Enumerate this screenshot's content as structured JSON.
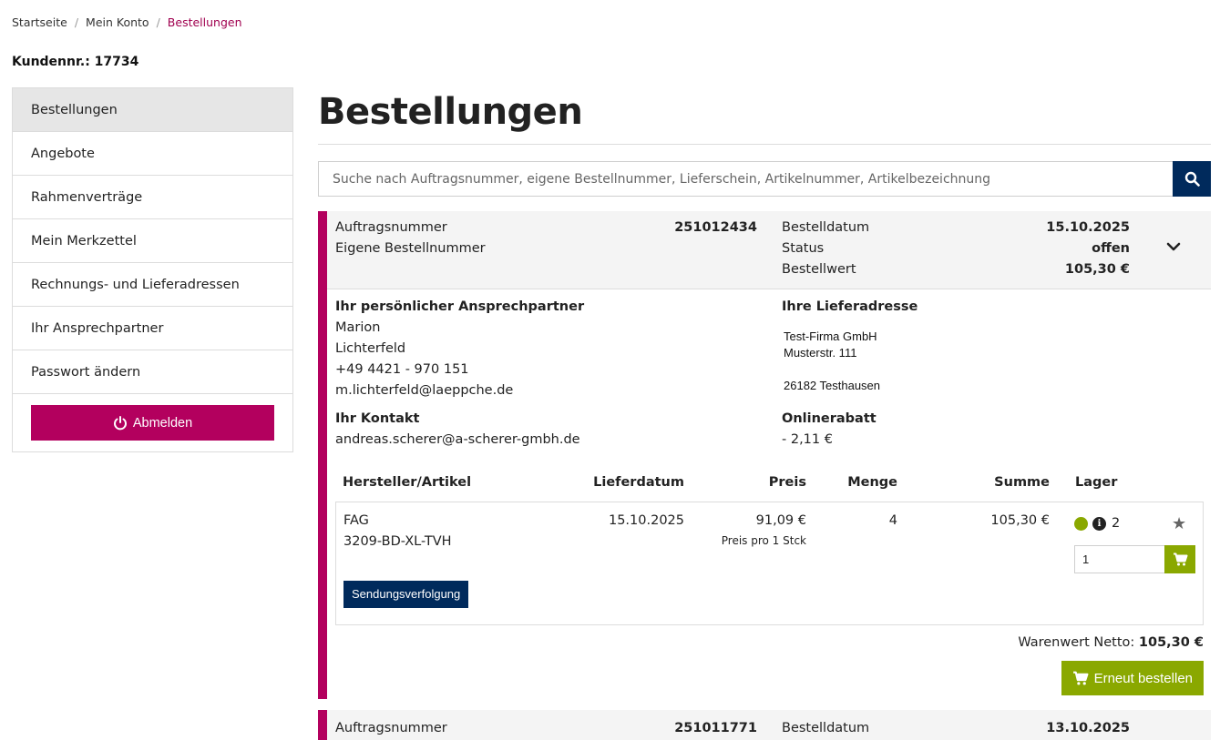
{
  "breadcrumb": {
    "home": "Startseite",
    "account": "Mein Konto",
    "current": "Bestellungen",
    "sep": "/"
  },
  "customer": "Kundennr.: 17734",
  "sidebar": {
    "items": [
      {
        "label": "Bestellungen"
      },
      {
        "label": "Angebote"
      },
      {
        "label": "Rahmenverträge"
      },
      {
        "label": "Mein Merkzettel"
      },
      {
        "label": "Rechnungs- und Lieferadressen"
      },
      {
        "label": "Ihr Ansprechpartner"
      },
      {
        "label": "Passwort ändern"
      }
    ],
    "logout": "Abmelden"
  },
  "page_title": "Bestellungen",
  "search": {
    "placeholder": "Suche nach Auftragsnummer, eigene Bestellnummer, Lieferschein, Artikelnummer, Artikelbezeichnung"
  },
  "order1": {
    "order_no_label": "Auftragsnummer",
    "order_no": "251012434",
    "own_no_label": "Eigene Bestellnummer",
    "date_label": "Bestelldatum",
    "date": "15.10.2025",
    "status_label": "Status",
    "status": "offen",
    "value_label": "Bestellwert",
    "value": "105,30 €",
    "contact_title": "Ihr persönlicher Ansprechpartner",
    "contact_first": "Marion",
    "contact_last": "Lichterfeld",
    "contact_phone": "+49 4421 - 970 151",
    "contact_email": "m.lichterfeld@laeppche.de",
    "own_contact_title": "Ihr Kontakt",
    "own_contact_email": "andreas.scherer@a-scherer-gmbh.de",
    "delivery_title": "Ihre Lieferadresse",
    "delivery_company": "Test-Firma GmbH",
    "delivery_street": "Musterstr. 111",
    "delivery_city": "26182 Testhausen",
    "discount_title": "Onlinerabatt",
    "discount": "- 2,11 €",
    "columns": {
      "article": "Hersteller/Artikel",
      "delivery": "Lieferdatum",
      "price": "Preis",
      "qty": "Menge",
      "sum": "Summe",
      "stock": "Lager"
    },
    "item": {
      "manufacturer": "FAG",
      "article": "3209-BD-XL-TVH",
      "delivery_date": "15.10.2025",
      "price": "91,09 €",
      "price_unit": "Preis pro 1 Stck",
      "qty": "4",
      "sum": "105,30 €",
      "stock": "2",
      "stock_status_color": "#8aa800",
      "order_qty": "1",
      "tracking": "Sendungsverfolgung"
    },
    "net_label": "Warenwert Netto:",
    "net_value": "105,30 €",
    "reorder": "Erneut bestellen"
  },
  "order2": {
    "order_no_label": "Auftragsnummer",
    "order_no": "251011771",
    "date_label": "Bestelldatum",
    "date": "13.10.2025"
  },
  "colors": {
    "accent": "#b3005e",
    "navy": "#002a5c",
    "green": "#8aa800"
  }
}
